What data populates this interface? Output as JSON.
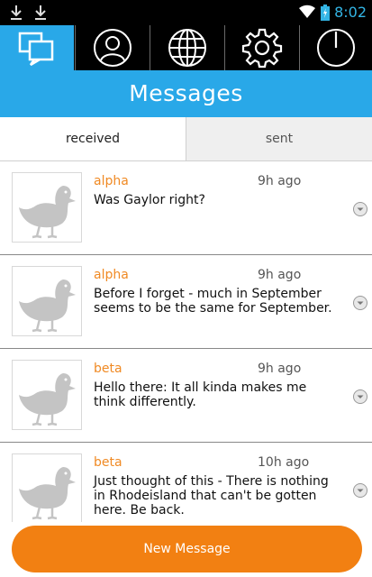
{
  "status": {
    "time": "8:02"
  },
  "tabs": [
    {
      "icon": "messages-icon",
      "active": true
    },
    {
      "icon": "profile-icon",
      "active": false
    },
    {
      "icon": "globe-icon",
      "active": false
    },
    {
      "icon": "settings-gear-icon",
      "active": false
    },
    {
      "icon": "power-icon",
      "active": false
    }
  ],
  "header": {
    "title": "Messages"
  },
  "segments": {
    "received": "received",
    "sent": "sent",
    "selected": "received"
  },
  "messages": [
    {
      "sender": "alpha",
      "time": "9h ago",
      "text": "Was Gaylor right?"
    },
    {
      "sender": "alpha",
      "time": "9h ago",
      "text": "Before I forget - much in September seems to be the same for September."
    },
    {
      "sender": "beta",
      "time": "9h ago",
      "text": "Hello there: It all kinda makes me think differently."
    },
    {
      "sender": "beta",
      "time": "10h ago",
      "text": "Just thought of this - There is nothing in Rhodeisland that can't be gotten here. Be back."
    }
  ],
  "footer": {
    "new_message_label": "New Message"
  },
  "colors": {
    "accent_blue": "#29a8e8",
    "accent_orange": "#f28012",
    "sender_orange": "#f08a24"
  }
}
